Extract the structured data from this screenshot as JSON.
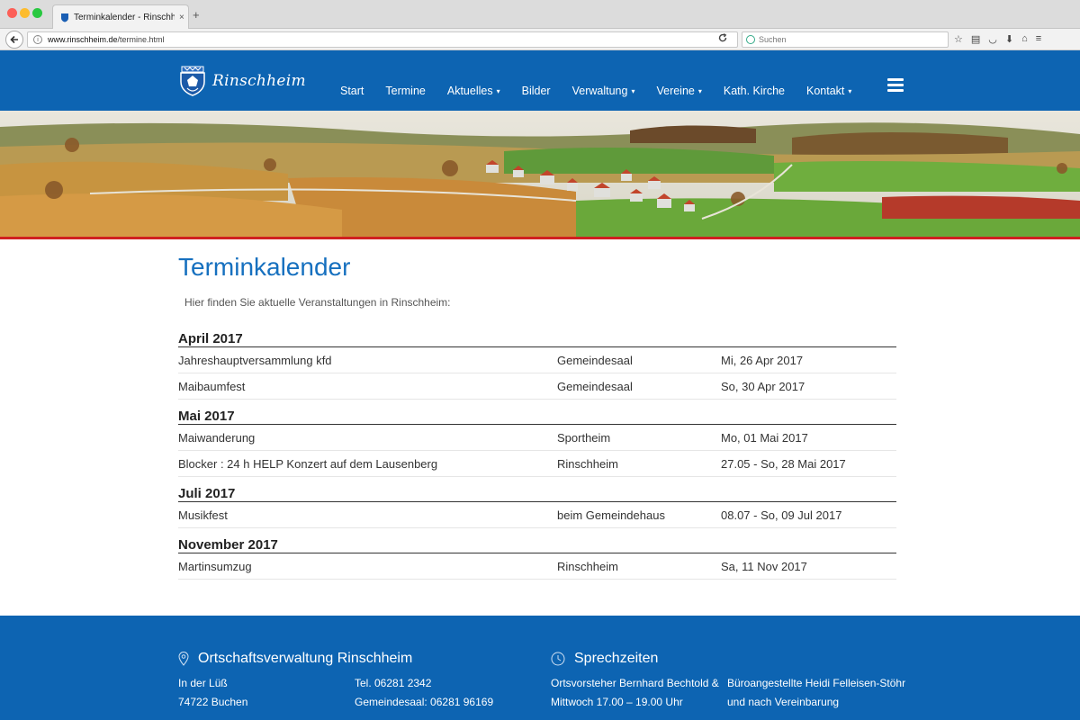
{
  "browser": {
    "tab_title": "Terminkalender - Rinschheim",
    "tab_close": "×",
    "new_tab": "+",
    "url_host": "www.rinschheim.de",
    "url_path": "/termine.html",
    "search_placeholder": "Suchen"
  },
  "site": {
    "logo_text": "Rinschheim",
    "nav": [
      {
        "label": "Start",
        "dropdown": false
      },
      {
        "label": "Termine",
        "dropdown": false
      },
      {
        "label": "Aktuelles",
        "dropdown": true
      },
      {
        "label": "Bilder",
        "dropdown": false
      },
      {
        "label": "Verwaltung",
        "dropdown": true
      },
      {
        "label": "Vereine",
        "dropdown": true
      },
      {
        "label": "Kath. Kirche",
        "dropdown": false
      },
      {
        "label": "Kontakt",
        "dropdown": true
      }
    ],
    "colors": {
      "brand_blue": "#0d64b2",
      "title_blue": "#1670bf",
      "accent_red": "#d02020"
    }
  },
  "main": {
    "title": "Terminkalender",
    "intro": "Hier finden Sie aktuelle Veranstaltungen in Rinschheim:",
    "months": [
      {
        "month": "April 2017",
        "events": [
          {
            "title": "Jahreshauptversammlung kfd",
            "place": "Gemeindesaal",
            "date": "Mi, 26 Apr 2017"
          },
          {
            "title": "Maibaumfest",
            "place": "Gemeindesaal",
            "date": "So, 30 Apr 2017"
          }
        ]
      },
      {
        "month": "Mai 2017",
        "events": [
          {
            "title": "Maiwanderung",
            "place": "Sportheim",
            "date": "Mo, 01 Mai 2017"
          },
          {
            "title": "Blocker : 24 h HELP Konzert auf dem Lausenberg",
            "place": "Rinschheim",
            "date": "27.05 - So, 28 Mai 2017"
          }
        ]
      },
      {
        "month": "Juli 2017",
        "events": [
          {
            "title": "Musikfest",
            "place": "beim Gemeindehaus",
            "date": "08.07 - So, 09 Jul 2017"
          }
        ]
      },
      {
        "month": "November 2017",
        "events": [
          {
            "title": "Martinsumzug",
            "place": "Rinschheim",
            "date": "Sa, 11 Nov 2017"
          }
        ]
      }
    ]
  },
  "footer": {
    "office": {
      "heading": "Ortschaftsverwaltung Rinschheim",
      "street": "In der Lüß",
      "city": "74722 Buchen",
      "phone": "Tel. 06281 2342",
      "hall_phone": "Gemeindesaal: 06281 96169"
    },
    "hours": {
      "heading": "Sprechzeiten",
      "line1": "Ortsvorsteher Bernhard Bechtold &",
      "line2": "Mittwoch 17.00 – 19.00 Uhr",
      "line3": "Büroangestellte Heidi Felleisen-Stöhr",
      "line4": "und nach Vereinbarung"
    }
  }
}
